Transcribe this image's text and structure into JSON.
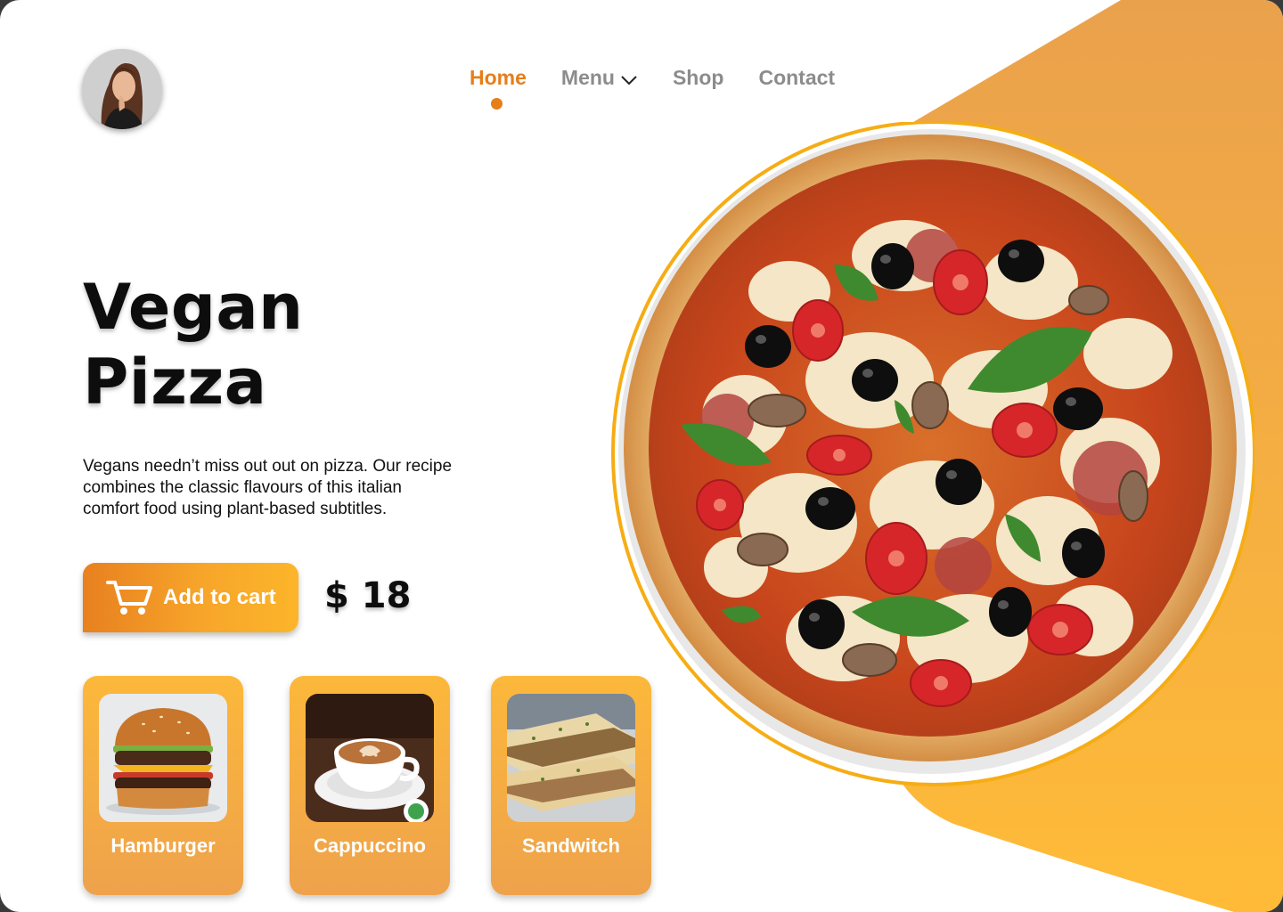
{
  "nav": {
    "items": [
      {
        "label": "Home",
        "active": true
      },
      {
        "label": "Menu",
        "has_dropdown": true
      },
      {
        "label": "Shop"
      },
      {
        "label": "Contact"
      }
    ]
  },
  "hero": {
    "title_line1": "Vegan",
    "title_line2": "Pizza",
    "description": "Vegans needn’t miss out out on pizza. Our recipe combines the classic flavours of this italian comfort food using plant-based subtitles.",
    "add_to_cart_label": "Add to cart",
    "price": "$ 18"
  },
  "products": [
    {
      "label": "Hamburger"
    },
    {
      "label": "Cappuccino"
    },
    {
      "label": "Sandwitch"
    }
  ],
  "colors": {
    "accent": "#e67e1a",
    "orange_light": "#fcb83a",
    "orange_shape": "#eea24c",
    "nav_inactive": "#8c8c8c"
  },
  "icons": [
    "avatar-photo",
    "chevron-down-icon",
    "cart-icon",
    "pizza-image",
    "hamburger-image",
    "cappuccino-image",
    "sandwich-image"
  ]
}
